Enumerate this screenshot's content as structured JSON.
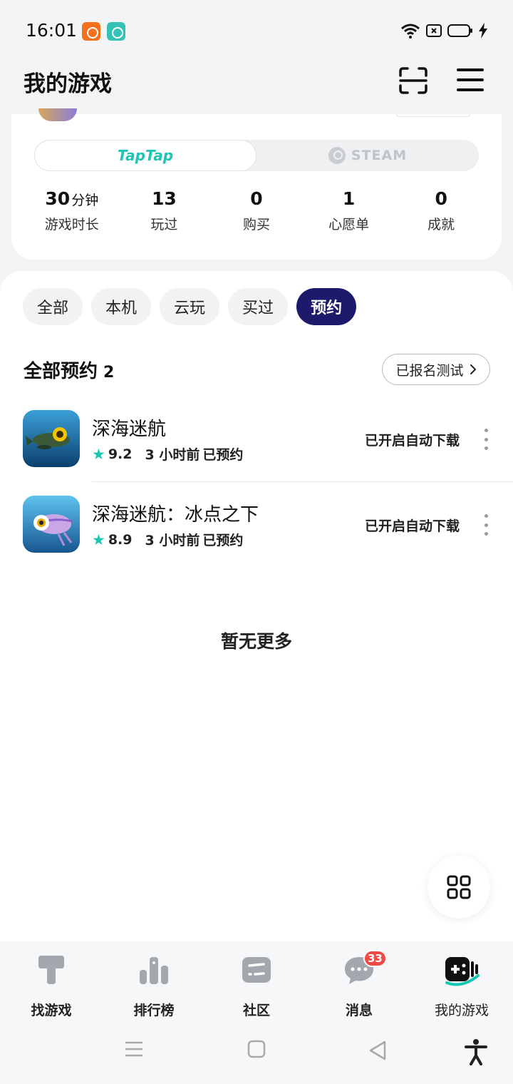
{
  "status_bar": {
    "time": "16:01",
    "notification_apps": [
      "kuaishou-icon",
      "chat-app-icon"
    ],
    "system_icons": [
      "wifi-icon",
      "sim-icon",
      "battery-icon",
      "charging-icon"
    ]
  },
  "header": {
    "title": "我的游戏",
    "scan_icon": "scan-icon",
    "menu_icon": "hamburger-menu-icon"
  },
  "profile": {
    "platform_tabs": [
      {
        "label": "TapTap",
        "active": true
      },
      {
        "label": "STEAM",
        "active": false
      }
    ],
    "stats": [
      {
        "value": "30",
        "unit": "分钟",
        "label": "游戏时长"
      },
      {
        "value": "13",
        "unit": "",
        "label": "玩过"
      },
      {
        "value": "0",
        "unit": "",
        "label": "购买"
      },
      {
        "value": "1",
        "unit": "",
        "label": "心愿单"
      },
      {
        "value": "0",
        "unit": "",
        "label": "成就"
      }
    ]
  },
  "filters": {
    "chips": [
      {
        "label": "全部",
        "active": false
      },
      {
        "label": "本机",
        "active": false
      },
      {
        "label": "云玩",
        "active": false
      },
      {
        "label": "买过",
        "active": false
      },
      {
        "label": "预约",
        "active": true
      }
    ]
  },
  "reservations": {
    "title": "全部预约",
    "count": "2",
    "signup_button": "已报名测试",
    "games": [
      {
        "name": "深海迷航",
        "rating": "9.2",
        "time": "3 小时前",
        "state": "已预约",
        "status": "已开启自动下载"
      },
      {
        "name": "深海迷航：冰点之下",
        "rating": "8.9",
        "time": "3 小时前",
        "state": "已预约",
        "status": "已开启自动下载"
      }
    ],
    "end_text": "暂无更多"
  },
  "bottom_nav": {
    "items": [
      {
        "label": "找游戏",
        "icon": "find-games-icon",
        "active": false
      },
      {
        "label": "排行榜",
        "icon": "leaderboard-icon",
        "active": false
      },
      {
        "label": "社区",
        "icon": "community-icon",
        "active": false
      },
      {
        "label": "消息",
        "icon": "messages-icon",
        "active": false,
        "badge": "33"
      },
      {
        "label": "我的游戏",
        "icon": "my-games-icon",
        "active": true
      }
    ]
  },
  "colors": {
    "accent": "#14c7b3",
    "active_chip": "#1d1a6b",
    "badge": "#f04a45"
  }
}
